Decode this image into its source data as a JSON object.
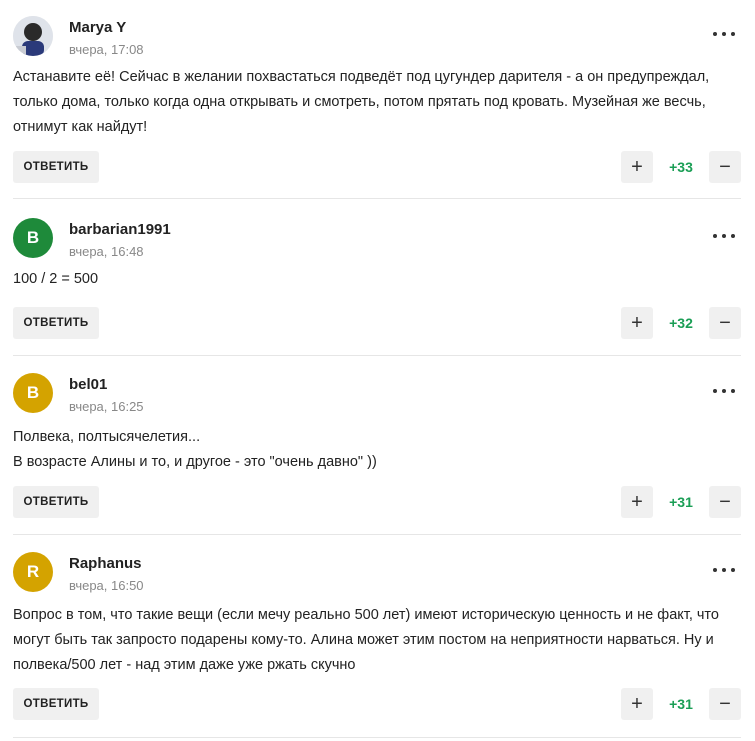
{
  "comments": [
    {
      "author": "Marya Y",
      "time": "вчера, 17:08",
      "avatar": {
        "type": "photo",
        "letter": "",
        "color": "#e8e8e8"
      },
      "lines": [
        "Астанавите её! Сейчас в желании похвастаться подведёт под цугундер дарителя - а он предупреждал,",
        "только дома, только когда одна открывать и смотреть, потом прятать под кровать. Музейная же весчь,",
        "отнимут как найдут!"
      ],
      "reply_label": "ОТВЕТИТЬ",
      "score": "+33"
    },
    {
      "author": "barbarian1991",
      "time": "вчера, 16:48",
      "avatar": {
        "type": "letter",
        "letter": "B",
        "color": "#1e8a3a"
      },
      "lines": [
        "100 / 2 = 500"
      ],
      "reply_label": "ОТВЕТИТЬ",
      "score": "+32"
    },
    {
      "author": "bel01",
      "time": "вчера, 16:25",
      "avatar": {
        "type": "letter",
        "letter": "B",
        "color": "#d4a300"
      },
      "lines": [
        "Полвека, полтысячелетия...",
        "В возрасте Алины и то, и другое - это \"очень давно\" ))"
      ],
      "reply_label": "ОТВЕТИТЬ",
      "score": "+31"
    },
    {
      "author": "Raphanus",
      "time": "вчера, 16:50",
      "avatar": {
        "type": "letter",
        "letter": "R",
        "color": "#d4a300"
      },
      "lines": [
        "Вопрос в том, что такие вещи (если мечу реально 500 лет) имеют историческую ценность и не факт, что",
        "могут быть так запросто подарены кому-то. Алина может этим постом на неприятности нарваться. Ну и",
        "полвека/500 лет - над этим даже уже ржать скучно"
      ],
      "reply_label": "ОТВЕТИТЬ",
      "score": "+31"
    }
  ],
  "icons": {
    "upvote": "+",
    "downvote": "−",
    "more": "more-dots-icon"
  },
  "colors": {
    "score": "#1a9e55",
    "button_bg": "#f0f0f0"
  }
}
